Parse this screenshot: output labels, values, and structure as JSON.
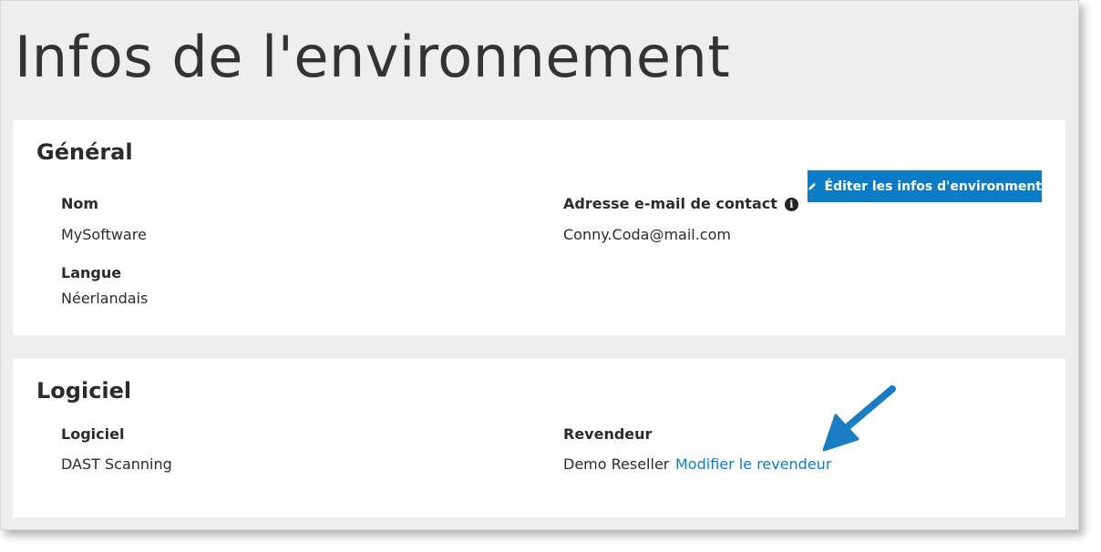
{
  "page": {
    "title": "Infos de l'environnement"
  },
  "general": {
    "title": "Général",
    "edit_button_label": "Éditer les infos d'environment",
    "name_label": "Nom",
    "name_value": "MySoftware",
    "email_label": "Adresse e-mail de contact",
    "email_value": "Conny.Coda@mail.com",
    "language_label": "Langue",
    "language_value": "Néerlandais"
  },
  "software": {
    "title": "Logiciel",
    "software_label": "Logiciel",
    "software_value": "DAST Scanning",
    "reseller_label": "Revendeur",
    "reseller_value": "Demo Reseller",
    "change_reseller_link": "Modifier le revendeur"
  },
  "icons": {
    "info": "info-icon",
    "edit": "pencil-icon",
    "annotation": "arrow-icon"
  },
  "colors": {
    "accent": "#0b7cc5",
    "frame_background": "#eeeeee",
    "card_background": "#ffffff",
    "text": "#2b2b2b"
  }
}
